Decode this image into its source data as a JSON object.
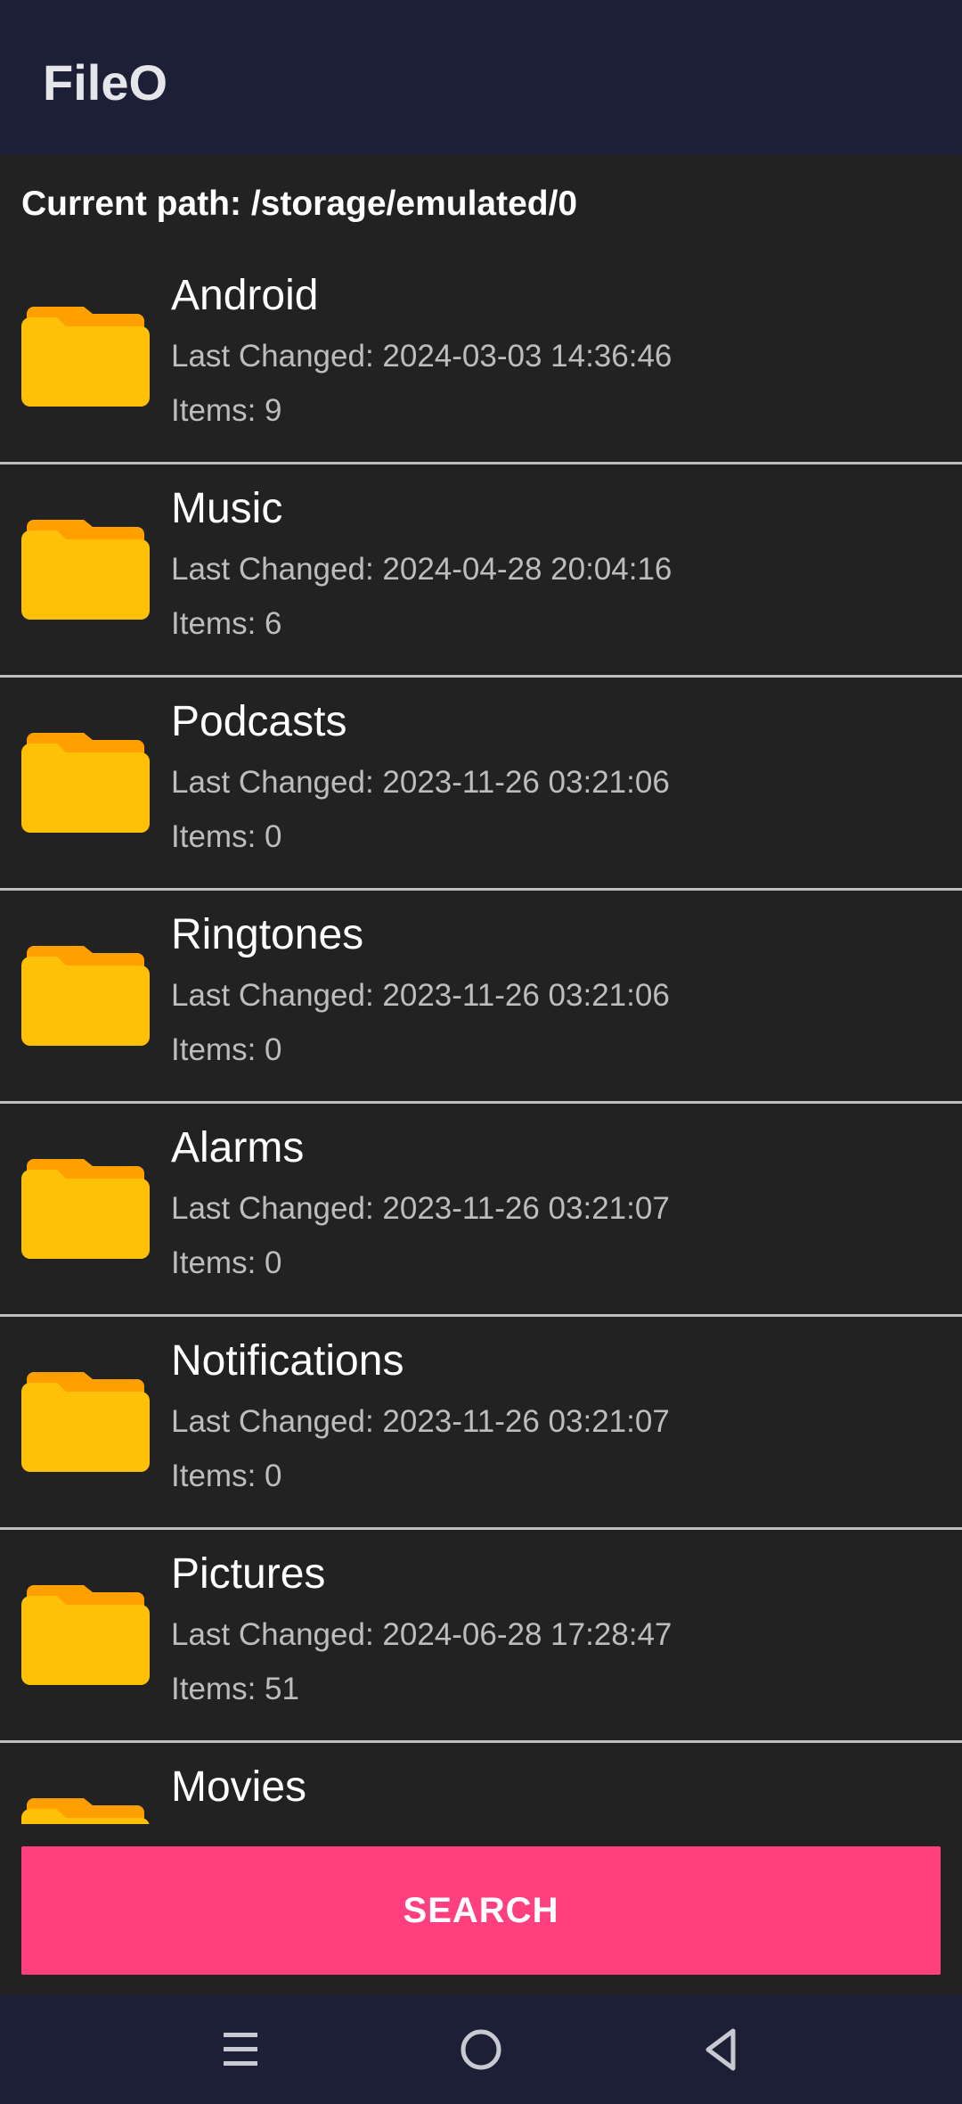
{
  "app": {
    "title": "FileO"
  },
  "path_label": "Current path: /storage/emulated/0",
  "folders": [
    {
      "name": "Android",
      "changed": "Last Changed: 2024-03-03 14:36:46",
      "items": "Items: 9"
    },
    {
      "name": "Music",
      "changed": "Last Changed: 2024-04-28 20:04:16",
      "items": "Items: 6"
    },
    {
      "name": "Podcasts",
      "changed": "Last Changed: 2023-11-26 03:21:06",
      "items": "Items: 0"
    },
    {
      "name": "Ringtones",
      "changed": "Last Changed: 2023-11-26 03:21:06",
      "items": "Items: 0"
    },
    {
      "name": "Alarms",
      "changed": "Last Changed: 2023-11-26 03:21:07",
      "items": "Items: 0"
    },
    {
      "name": "Notifications",
      "changed": "Last Changed: 2023-11-26 03:21:07",
      "items": "Items: 0"
    },
    {
      "name": "Pictures",
      "changed": "Last Changed: 2024-06-28 17:28:47",
      "items": "Items: 51"
    },
    {
      "name": "Movies"
    }
  ],
  "search_button": {
    "label": "SEARCH"
  },
  "nav": {
    "icons": [
      "menu-icon",
      "home-circle-icon",
      "back-triangle-icon"
    ]
  },
  "colors": {
    "app_bar": "#1d1f36",
    "background": "#222222",
    "folder_front": "#ffc107",
    "folder_back": "#ff9f00",
    "search_button": "#ff3f7e",
    "divider": "#bfbfbf"
  }
}
